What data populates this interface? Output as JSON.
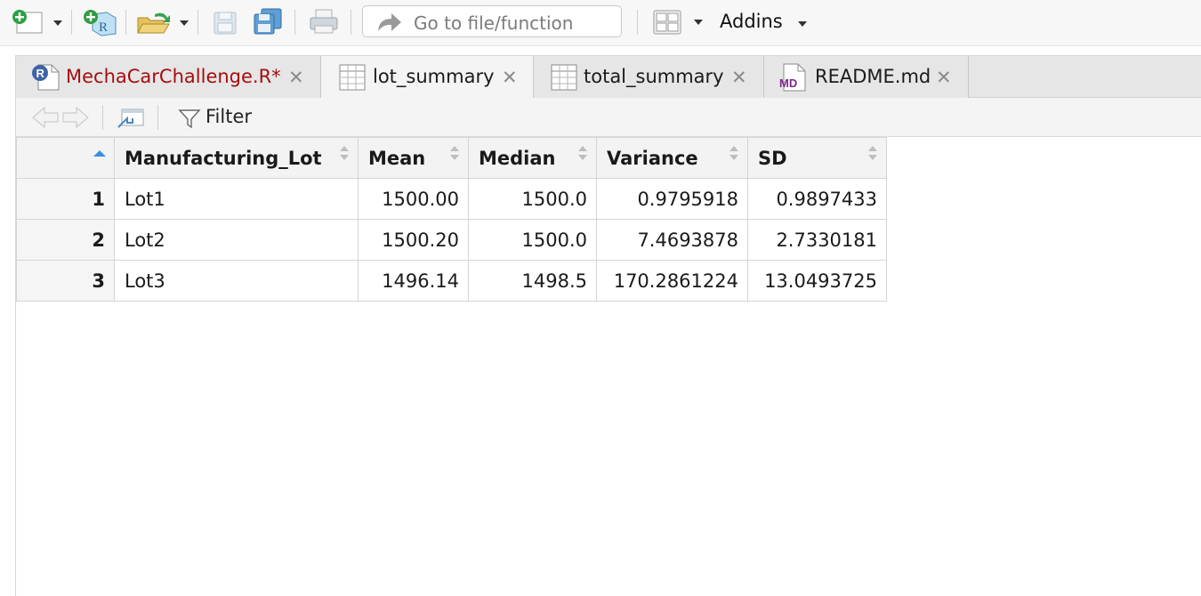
{
  "toolbar": {
    "goto_placeholder": "Go to file/function",
    "addins_label": "Addins",
    "icons": [
      "new-file-icon",
      "new-project-icon",
      "open-file-icon",
      "save-icon",
      "save-all-icon",
      "print-icon",
      "goto-arrow-icon",
      "pane-layout-icon"
    ]
  },
  "tabs": [
    {
      "label": "MechaCarChallenge.R*",
      "icon": "r-script-icon",
      "color": "#a50e0e",
      "active": false
    },
    {
      "label": "lot_summary",
      "icon": "table-icon",
      "color": "#1a1a1a",
      "active": true
    },
    {
      "label": "total_summary",
      "icon": "table-icon",
      "color": "#1a1a1a",
      "active": false
    },
    {
      "label": "README.md",
      "icon": "markdown-icon",
      "color": "#1a1a1a",
      "active": false
    }
  ],
  "viewer": {
    "filter_label": "Filter"
  },
  "table": {
    "columns": [
      "Manufacturing_Lot",
      "Mean",
      "Median",
      "Variance",
      "SD"
    ],
    "rows": [
      {
        "n": "1",
        "lot": "Lot1",
        "mean": "1500.00",
        "median": "1500.0",
        "variance": "0.9795918",
        "sd": "0.9897433"
      },
      {
        "n": "2",
        "lot": "Lot2",
        "mean": "1500.20",
        "median": "1500.0",
        "variance": "7.4693878",
        "sd": "2.7330181"
      },
      {
        "n": "3",
        "lot": "Lot3",
        "mean": "1496.14",
        "median": "1498.5",
        "variance": "170.2861224",
        "sd": "13.0493725"
      }
    ]
  },
  "colors": {
    "accent_sort": "#3a8ee6",
    "modified_tab": "#a50e0e"
  }
}
